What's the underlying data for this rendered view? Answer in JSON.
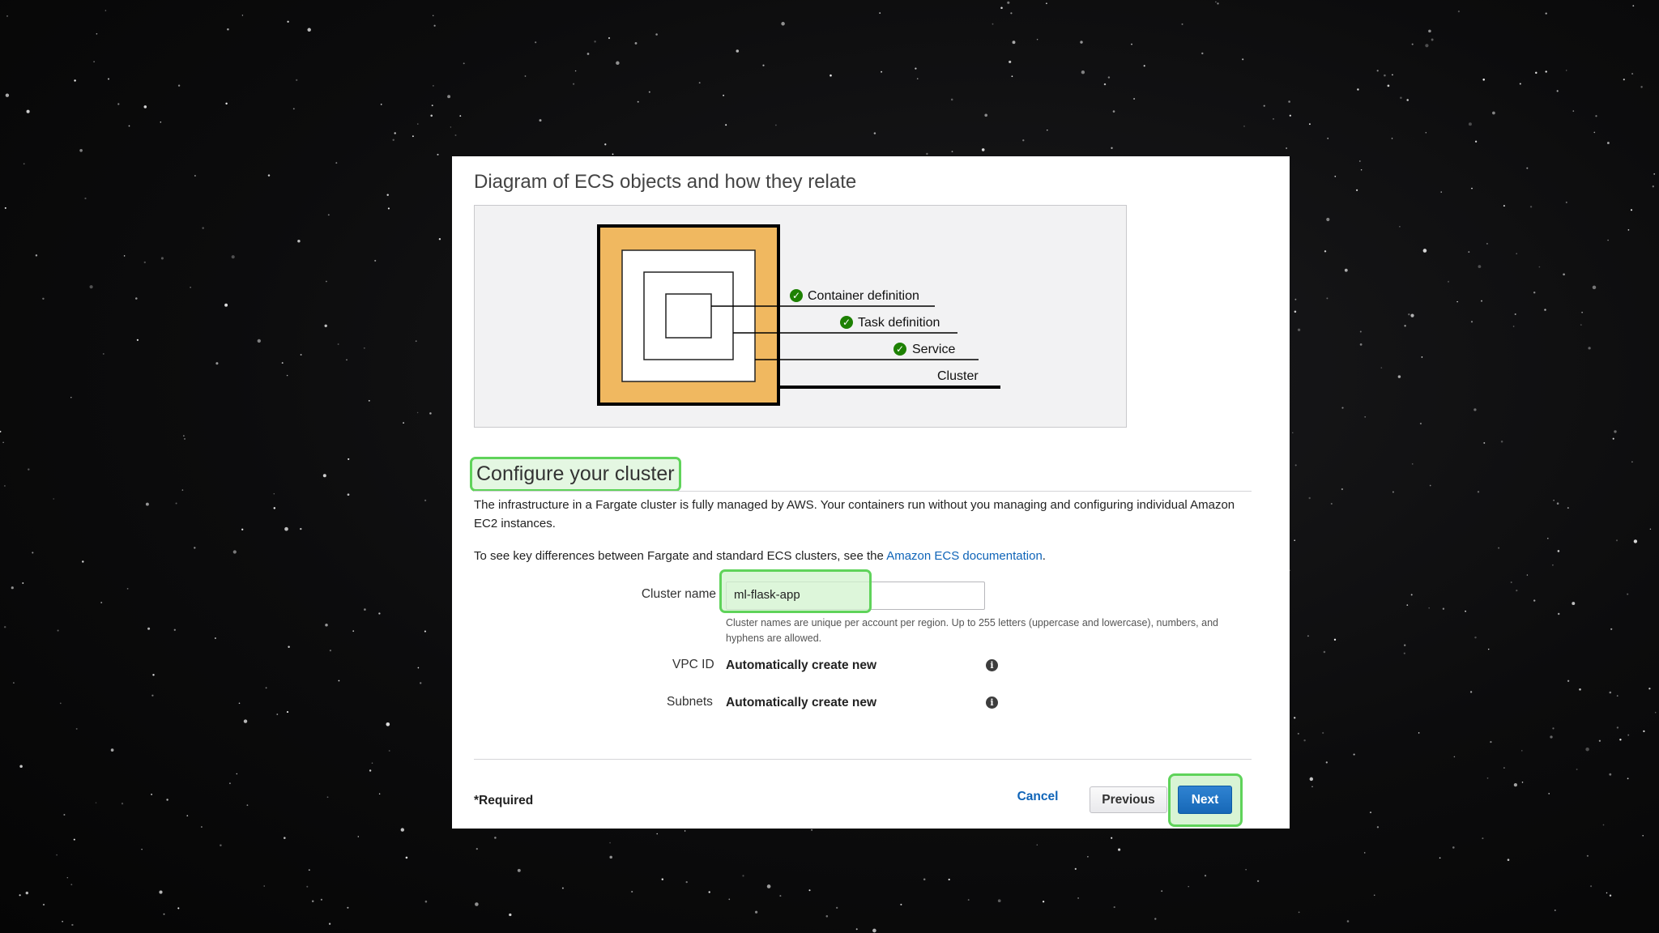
{
  "diagram": {
    "title": "Diagram of ECS objects and how they relate",
    "labels": {
      "container_definition": "Container definition",
      "task_definition": "Task definition",
      "service": "Service",
      "cluster": "Cluster"
    },
    "colors": {
      "cluster_fill": "#f0b860",
      "check": "#1d8102"
    }
  },
  "configure": {
    "heading": "Configure your cluster",
    "description": "The infrastructure in a Fargate cluster is fully managed by AWS. Your containers run without you managing and configuring individual Amazon EC2 instances.",
    "differences_prefix": "To see key differences between Fargate and standard ECS clusters, see the ",
    "differences_link": "Amazon ECS documentation",
    "differences_suffix": "."
  },
  "form": {
    "cluster_name_label": "Cluster name",
    "cluster_name_value": "ml-flask-app",
    "cluster_name_help": "Cluster names are unique per account per region. Up to 255 letters (uppercase and lowercase), numbers, and hyphens are allowed.",
    "vpc_label": "VPC ID",
    "vpc_value": "Automatically create new",
    "subnets_label": "Subnets",
    "subnets_value": "Automatically create new",
    "info_icon": "info-icon"
  },
  "footer": {
    "required_note": "*Required",
    "cancel_label": "Cancel",
    "previous_label": "Previous",
    "next_label": "Next"
  },
  "colors": {
    "highlight": "#5fd35a",
    "primary_button": "#1768b7",
    "link": "#0f64b8"
  }
}
